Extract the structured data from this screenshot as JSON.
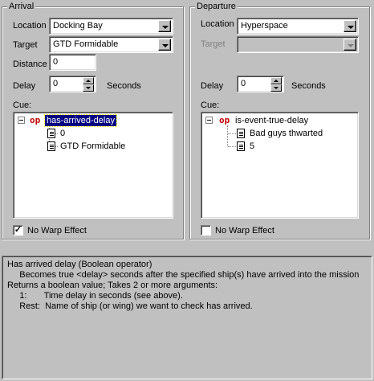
{
  "arrival": {
    "title": "Arrival",
    "location_label": "Location",
    "location_value": "Docking Bay",
    "target_label": "Target",
    "target_value": "GTD Formidable",
    "distance_label": "Distance",
    "distance_value": "0",
    "delay_label": "Delay",
    "delay_value": "0",
    "seconds_label": "Seconds",
    "cue_label": "Cue:",
    "cue_tree": {
      "operator_tag": "op",
      "operator": "has-arrived-delay",
      "args": [
        "0",
        "GTD Formidable"
      ]
    },
    "no_warp_label": "No Warp Effect",
    "no_warp_checked": true
  },
  "departure": {
    "title": "Departure",
    "location_label": "Location",
    "location_value": "Hyperspace",
    "target_label": "Target",
    "target_value": "",
    "delay_label": "Delay",
    "delay_value": "0",
    "seconds_label": "Seconds",
    "cue_label": "Cue:",
    "cue_tree": {
      "operator_tag": "op",
      "operator": "is-event-true-delay",
      "args": [
        "Bad guys thwarted",
        "5"
      ]
    },
    "no_warp_label": "No Warp Effect",
    "no_warp_checked": false
  },
  "help": {
    "lines": [
      "Has arrived delay (Boolean operator)",
      "     Becomes true <delay> seconds after the specified ship(s) have arrived into the mission",
      "",
      "Returns a boolean value; Takes 2 or more arguments:",
      "     1:       Time delay in seconds (see above).",
      "     Rest:  Name of ship (or wing) we want to check has arrived."
    ]
  },
  "colors": {
    "window_bg": "#c0c0c0",
    "selection_bg": "#000080",
    "operator_tag": "#c00000"
  },
  "icons": {
    "expand": "minus-box-icon",
    "argument": "document-icon",
    "dropdown": "chevron-down-icon"
  }
}
